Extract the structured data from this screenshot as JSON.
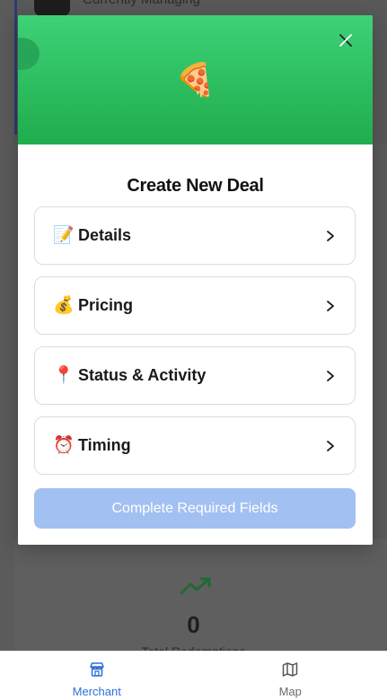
{
  "background": {
    "managing_label": "Currently Managing",
    "stat_value": "0",
    "stat_label": "Total Redemptions"
  },
  "modal": {
    "banner_emoji": "🍕",
    "title": "Create New Deal",
    "sections": [
      {
        "emoji": "📝",
        "label": "Details"
      },
      {
        "emoji": "💰",
        "label": "Pricing"
      },
      {
        "emoji": "📍",
        "label": "Status & Activity"
      },
      {
        "emoji": "⏰",
        "label": "Timing"
      }
    ],
    "submit_label": "Complete Required Fields"
  },
  "tabbar": {
    "tabs": [
      {
        "label": "Merchant",
        "icon": "store-icon",
        "active": true
      },
      {
        "label": "Map",
        "icon": "map-icon",
        "active": false
      }
    ]
  },
  "colors": {
    "banner_green": "#2fbf62",
    "accent_blue": "#2f6fd8",
    "disabled_button": "#a3c0f2",
    "trend_green": "#1e8f3c"
  }
}
